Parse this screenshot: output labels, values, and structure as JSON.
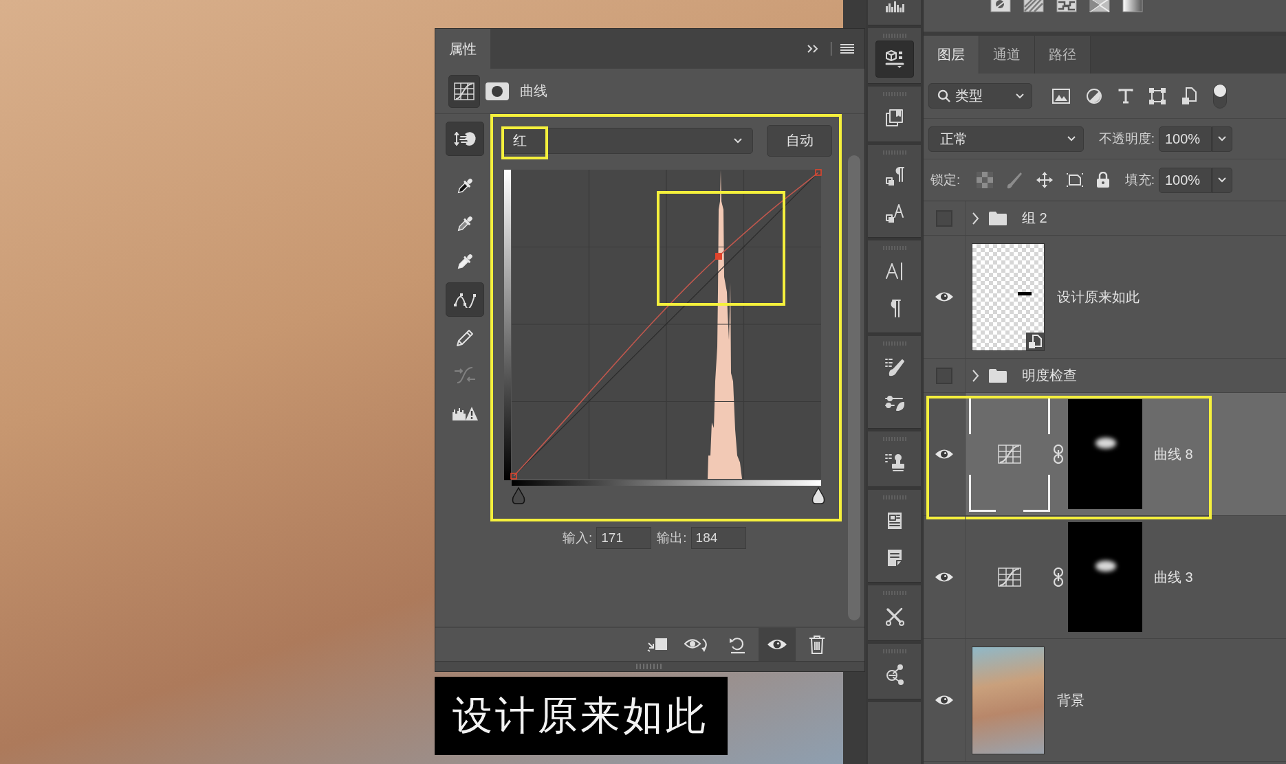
{
  "canvas": {
    "caption": "设计原来如此"
  },
  "properties_panel": {
    "tab": "属性",
    "adjustment": "曲线",
    "channel": "红",
    "auto_button": "自动",
    "input_label": "输入:",
    "input_value": "171",
    "output_label": "输出:",
    "output_value": "184",
    "highlights": {
      "curve_area": true,
      "channel": true,
      "midtones": true
    },
    "tools": [
      {
        "kind": "on-image",
        "selected": true,
        "disabled": false
      },
      {
        "kind": "eyedropper-black",
        "selected": false,
        "disabled": false
      },
      {
        "kind": "eyedropper-gray",
        "selected": false,
        "disabled": false
      },
      {
        "kind": "eyedropper-white",
        "selected": false,
        "disabled": false
      },
      {
        "kind": "point-curve",
        "selected": true,
        "disabled": false
      },
      {
        "kind": "pencil",
        "selected": false,
        "disabled": false
      },
      {
        "kind": "smooth",
        "selected": false,
        "disabled": true
      },
      {
        "kind": "clipping-warning",
        "selected": false,
        "disabled": false
      }
    ],
    "footer_buttons": [
      {
        "kind": "clip",
        "selected": false
      },
      {
        "kind": "view-previous",
        "selected": false
      },
      {
        "kind": "reset",
        "selected": false
      },
      {
        "kind": "visibility",
        "selected": true
      },
      {
        "kind": "delete",
        "selected": false
      }
    ]
  },
  "dock": {
    "groups": [
      {
        "items": [
          {
            "kind": "histogram",
            "selected": false
          }
        ]
      },
      {
        "items": [
          {
            "kind": "cube",
            "selected": true
          }
        ]
      },
      {
        "items": [
          {
            "kind": "bookmark-window",
            "selected": false
          }
        ]
      },
      {
        "items": [
          {
            "kind": "paragraph-styles",
            "selected": false
          },
          {
            "kind": "character-styles",
            "selected": false
          }
        ]
      },
      {
        "items": [
          {
            "kind": "character",
            "selected": false
          },
          {
            "kind": "paragraph",
            "selected": false
          }
        ]
      },
      {
        "items": [
          {
            "kind": "brush-presets",
            "selected": false
          },
          {
            "kind": "brush-settings",
            "selected": false
          }
        ]
      },
      {
        "items": [
          {
            "kind": "clone-source",
            "selected": false
          }
        ]
      },
      {
        "items": [
          {
            "kind": "info",
            "selected": false
          },
          {
            "kind": "notes",
            "selected": false
          }
        ]
      },
      {
        "items": [
          {
            "kind": "tool-presets",
            "selected": false
          }
        ]
      },
      {
        "items": [
          {
            "kind": "share",
            "selected": false
          }
        ]
      }
    ]
  },
  "layers_panel": {
    "tabs": [
      {
        "label": "图层",
        "selected": true
      },
      {
        "label": "通道",
        "selected": false
      },
      {
        "label": "路径",
        "selected": false
      }
    ],
    "filter_type": "类型",
    "filter_on": true,
    "blend_mode": "正常",
    "opacity_label": "不透明度:",
    "opacity": "100%",
    "lock_label": "锁定:",
    "fill_label": "填充:",
    "fill": "100%",
    "layers": [
      {
        "kind": "group",
        "name": "组 2",
        "visible": false,
        "selected": false,
        "highlighted": false
      },
      {
        "kind": "smart-object",
        "name": "设计原来如此",
        "visible": true,
        "selected": false,
        "highlighted": false
      },
      {
        "kind": "group",
        "name": "明度检查",
        "visible": false,
        "selected": false,
        "highlighted": false
      },
      {
        "kind": "adjustment",
        "name": "曲线 8",
        "visible": true,
        "selected": true,
        "highlighted": true
      },
      {
        "kind": "adjustment",
        "name": "曲线 3",
        "visible": true,
        "selected": false,
        "highlighted": false
      },
      {
        "kind": "pixel",
        "name": "背景",
        "visible": true,
        "selected": false,
        "highlighted": false
      }
    ]
  }
}
